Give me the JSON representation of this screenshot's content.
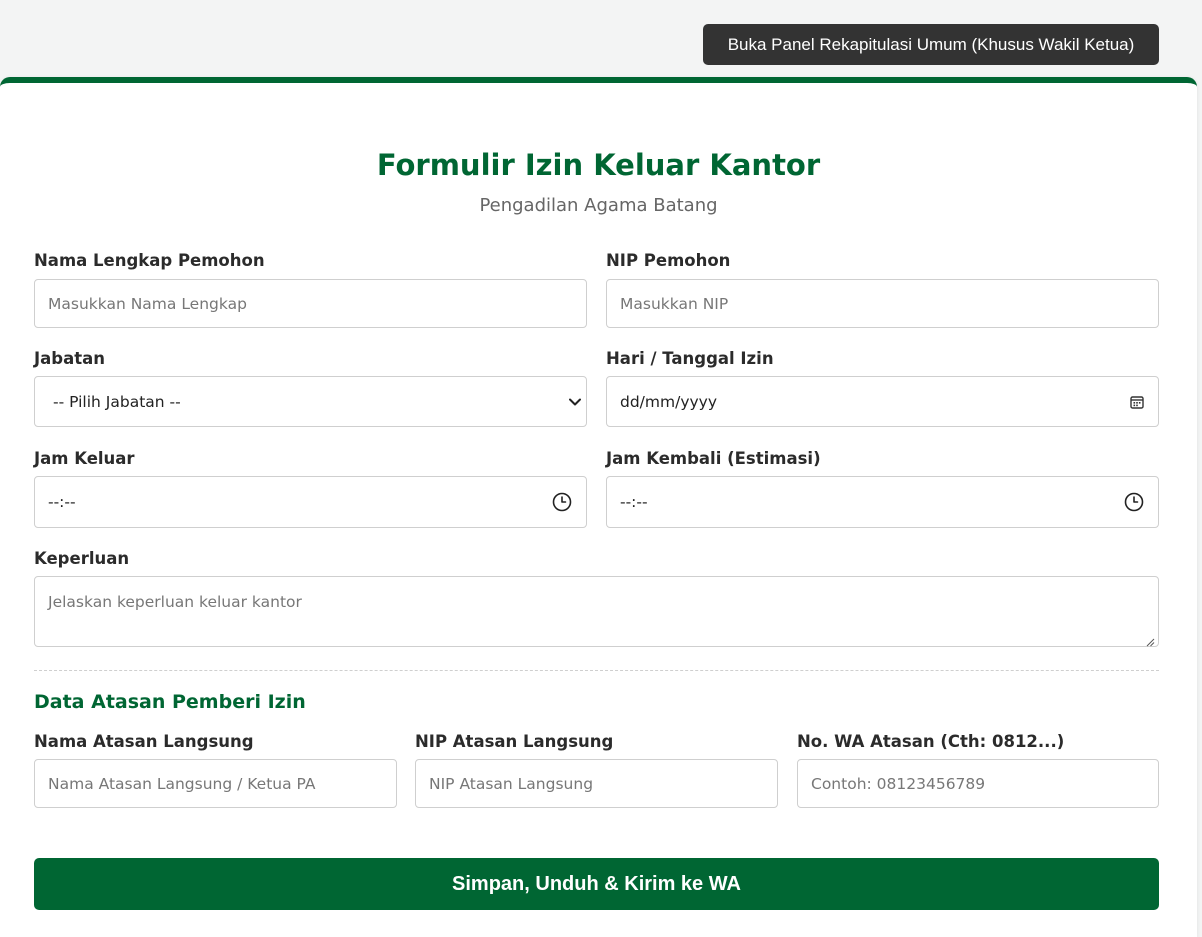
{
  "top_button": {
    "label": "Buka Panel Rekapitulasi Umum (Khusus Wakil Ketua)"
  },
  "form": {
    "title": "Formulir Izin Keluar Kantor",
    "subtitle": "Pengadilan Agama Batang",
    "fields": {
      "nama": {
        "label": "Nama Lengkap Pemohon",
        "placeholder": "Masukkan Nama Lengkap"
      },
      "nip": {
        "label": "NIP Pemohon",
        "placeholder": "Masukkan NIP"
      },
      "jabatan": {
        "label": "Jabatan",
        "selected": "-- Pilih Jabatan --"
      },
      "tanggal": {
        "label": "Hari / Tanggal Izin",
        "value": "dd/mm/yyyy"
      },
      "jam_keluar": {
        "label": "Jam Keluar",
        "value": "--:--"
      },
      "jam_kembali": {
        "label": "Jam Kembali (Estimasi)",
        "value": "--:--"
      },
      "keperluan": {
        "label": "Keperluan",
        "placeholder": "Jelaskan keperluan keluar kantor"
      }
    },
    "atasan": {
      "section_title": "Data Atasan Pemberi Izin",
      "nama": {
        "label": "Nama Atasan Langsung",
        "placeholder": "Nama Atasan Langsung / Ketua PA"
      },
      "nip": {
        "label": "NIP Atasan Langsung",
        "placeholder": "NIP Atasan Langsung"
      },
      "wa": {
        "label": "No. WA Atasan (Cth: 0812...)",
        "placeholder": "Contoh: 08123456789"
      }
    },
    "submit_label": "Simpan, Unduh & Kirim ke WA"
  },
  "colors": {
    "primary_green": "#006633",
    "dark_button": "#333333",
    "page_background": "#f3f4f4"
  },
  "icons": {
    "select": "chevron-down-icon",
    "date": "calendar-icon",
    "time": "clock-icon",
    "textarea": "resize-handle-icon"
  }
}
